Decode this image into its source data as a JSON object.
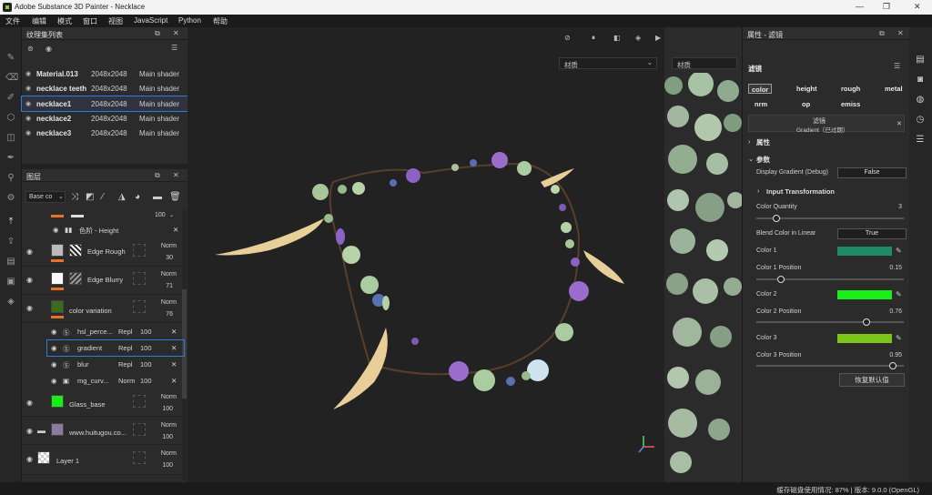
{
  "window": {
    "title": "Adobe Substance 3D Painter - Necklace"
  },
  "menu": [
    "文件",
    "编辑",
    "模式",
    "窗口",
    "视图",
    "JavaScript",
    "Python",
    "帮助"
  ],
  "texture_set_panel": {
    "title": "纹理集列表",
    "rows": [
      {
        "name": "Material.013",
        "resolution": "2048x2048",
        "shader": "Main shader"
      },
      {
        "name": "necklace teeth",
        "resolution": "2048x2048",
        "shader": "Main shader"
      },
      {
        "name": "necklace1",
        "resolution": "2048x2048",
        "shader": "Main shader"
      },
      {
        "name": "necklace2",
        "resolution": "2048x2048",
        "shader": "Main shader"
      },
      {
        "name": "necklace3",
        "resolution": "2048x2048",
        "shader": "Main shader"
      }
    ]
  },
  "layers_panel": {
    "title": "图层",
    "channel_select": "Base co",
    "height_row": {
      "label": "色阶 - Height",
      "opacity": "100"
    },
    "layers": [
      {
        "name": "Edge Rough",
        "blend": "Norm",
        "opacity": "30"
      },
      {
        "name": "Edge Blurry",
        "blend": "Norm",
        "opacity": "71"
      },
      {
        "name": "color variation",
        "blend": "Norm",
        "opacity": "76"
      },
      {
        "name": "Glass_base",
        "blend": "Norm",
        "opacity": "100"
      },
      {
        "name": "www.huitugou.co...",
        "blend": "Norm",
        "opacity": "100"
      },
      {
        "name": "Layer 1",
        "blend": "Norm",
        "opacity": "100"
      }
    ],
    "effects": [
      {
        "name": "hsl_perce...",
        "blend": "Repl",
        "opacity": "100"
      },
      {
        "name": "gradient",
        "blend": "Repl",
        "opacity": "100"
      },
      {
        "name": "blur",
        "blend": "Repl",
        "opacity": "100"
      },
      {
        "name": "mg_curv...",
        "blend": "Norm",
        "opacity": "100"
      }
    ]
  },
  "viewport": {
    "mode_3d": "材质",
    "mode_2d": "材质"
  },
  "properties": {
    "title": "属性 - 滤镜",
    "section": "滤镜",
    "channels": [
      "color",
      "height",
      "rough",
      "metal",
      "nrm",
      "op",
      "emiss"
    ],
    "filter_label": "滤镜",
    "filter_name": "Gradient（已过期）",
    "attributes": "属性",
    "params": "参数",
    "display_gradient_label": "Display Gradient (Debug)",
    "display_gradient_value": "False",
    "input_transformation": "Input Transformation",
    "color_quantity_label": "Color Quantity",
    "color_quantity_value": "3",
    "color_quantity_fraction": 0.12,
    "blend_linear_label": "Blend Color in Linear",
    "blend_linear_value": "True",
    "color1_label": "Color 1",
    "color1": "#1f8a66",
    "color1_pos_label": "Color 1 Position",
    "color1_pos": "0.15",
    "color2_label": "Color 2",
    "color2": "#19ee19",
    "color2_pos_label": "Color 2 Position",
    "color2_pos": "0.76",
    "color3_label": "Color 3",
    "color3": "#7cc41a",
    "color3_pos_label": "Color 3 Position",
    "color3_pos": "0.95",
    "reset_label": "恢复默认值"
  },
  "status": {
    "text": "缓存磁盘使用情况: 87% | 版本: 9.0.0 (OpenGL)"
  }
}
